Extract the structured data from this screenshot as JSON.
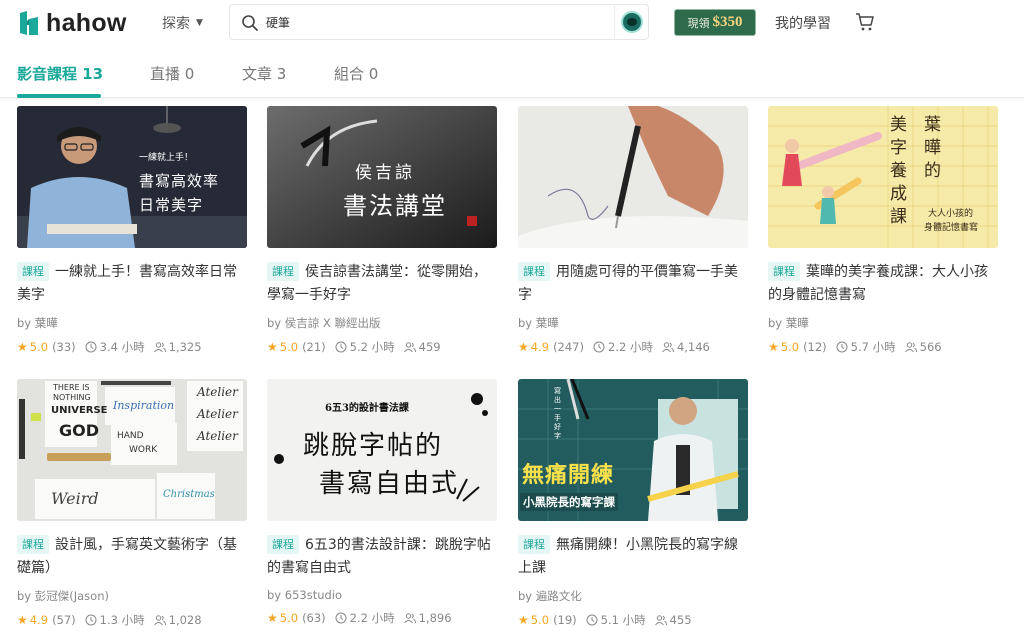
{
  "header": {
    "logo_text": "hahow",
    "explore_label": "探索",
    "search_value": "硬筆",
    "promo_label": "現領",
    "promo_amount": "$350",
    "my_learning": "我的學習"
  },
  "tabs": [
    {
      "label": "影音課程 13",
      "active": true
    },
    {
      "label": "直播 0",
      "active": false
    },
    {
      "label": "文章 3",
      "active": false
    },
    {
      "label": "組合 0",
      "active": false
    }
  ],
  "courses": [
    {
      "badge": "課程",
      "title": "一練就上手！書寫高效率日常美字",
      "author": "by 葉曄",
      "rating": "5.0",
      "reviews": "(33)",
      "hours": "3.4 小時",
      "students": "1,325",
      "thumb": {
        "line1": "一練就上手！",
        "line2": "書寫高效率",
        "line3": "日常美字"
      }
    },
    {
      "badge": "課程",
      "title": "侯吉諒書法講堂：從零開始，學寫一手好字",
      "author": "by 侯吉諒 X 聯經出版",
      "rating": "5.0",
      "reviews": "(21)",
      "hours": "5.2 小時",
      "students": "459",
      "thumb": {
        "line1": "侯吉諒",
        "line2": "書法講堂"
      }
    },
    {
      "badge": "課程",
      "title": "用隨處可得的平價筆寫一手美字",
      "author": "by 葉曄",
      "rating": "4.9",
      "reviews": "(247)",
      "hours": "2.2 小時",
      "students": "4,146",
      "thumb": {}
    },
    {
      "badge": "課程",
      "title": "葉曄的美字養成課：大人小孩的身體記憶書寫",
      "author": "by 葉曄",
      "rating": "5.0",
      "reviews": "(12)",
      "hours": "5.7 小時",
      "students": "566",
      "thumb": {
        "col1": "美字養成課",
        "col2": "葉曄的",
        "sub1": "大人小孩的",
        "sub2": "身體記憶書寫"
      }
    },
    {
      "badge": "課程",
      "title": "設計風，手寫英文藝術字（基礎篇）",
      "author": "by 彭冠傑(Jason)",
      "rating": "4.9",
      "reviews": "(57)",
      "hours": "1.3 小時",
      "students": "1,028",
      "thumb": {
        "w1": "THERE IS",
        "w2": "NOTHING",
        "w3": "UNIVERSE",
        "w4": "GOD",
        "w5": "Inspiration",
        "w6": "HAND",
        "w7": "WORK",
        "w8": "Atelier",
        "w9": "Atelier",
        "w10": "Atelier",
        "w11": "Weird",
        "w12": "Christmas"
      }
    },
    {
      "badge": "課程",
      "title": "6五3的書法設計課：跳脫字帖的書寫自由式",
      "author": "by 653studio",
      "rating": "5.0",
      "reviews": "(63)",
      "hours": "2.2 小時",
      "students": "1,896",
      "thumb": {
        "top": "6五3的設計書法課",
        "line1": "跳脫字帖的",
        "line2": "書寫自由式"
      }
    },
    {
      "badge": "課程",
      "title": "無痛開練！小黑院長的寫字線上課",
      "author": "by 遍路文化",
      "rating": "5.0",
      "reviews": "(19)",
      "hours": "5.1 小時",
      "students": "455",
      "thumb": {
        "line1": "無痛開練",
        "line2": "小黑院長的寫字課",
        "side": "寫出一手好字"
      }
    }
  ],
  "colors": {
    "accent": "#1aa89a",
    "star": "#f5a623",
    "promo_bg": "#2e6b4d"
  }
}
